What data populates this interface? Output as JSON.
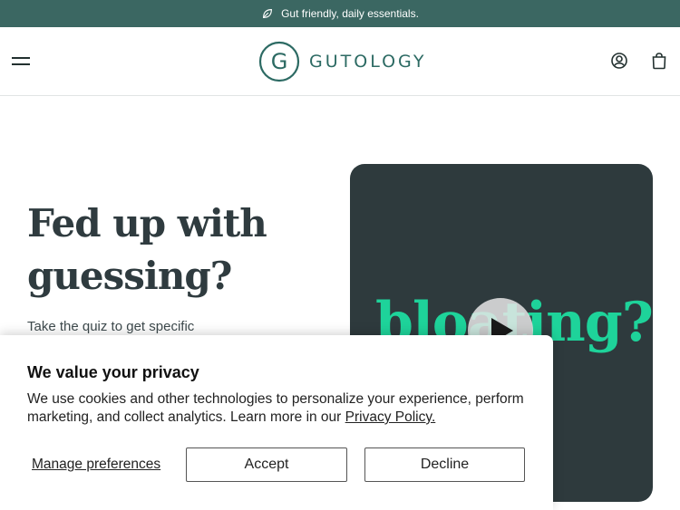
{
  "announcement": {
    "icon": "leaf-icon",
    "text": "Gut friendly, daily essentials."
  },
  "header": {
    "menu_icon": "hamburger-menu-icon",
    "logo_letter": "G",
    "logo_text": "GUTOLOGY",
    "account_icon": "user-account-icon",
    "cart_icon": "shopping-bag-icon"
  },
  "hero": {
    "title_line1": "Fed up with",
    "title_line2": "guessing?",
    "subtitle": "Take the quiz to get specific"
  },
  "video": {
    "overlay_word": "bloating?",
    "play_icon": "play-icon",
    "background_color": "#2e3a3d",
    "word_color": "#1ed39a"
  },
  "cookie_banner": {
    "title": "We value your privacy",
    "body_text": "We use cookies and other technologies to personalize your experience, perform marketing, and collect analytics. Learn more in our ",
    "policy_link": "Privacy Policy.",
    "manage_label": "Manage preferences",
    "accept_label": "Accept",
    "decline_label": "Decline"
  },
  "colors": {
    "announcement_bg": "#3b6762",
    "brand": "#2c6a63",
    "heading": "#2f3b3f"
  }
}
